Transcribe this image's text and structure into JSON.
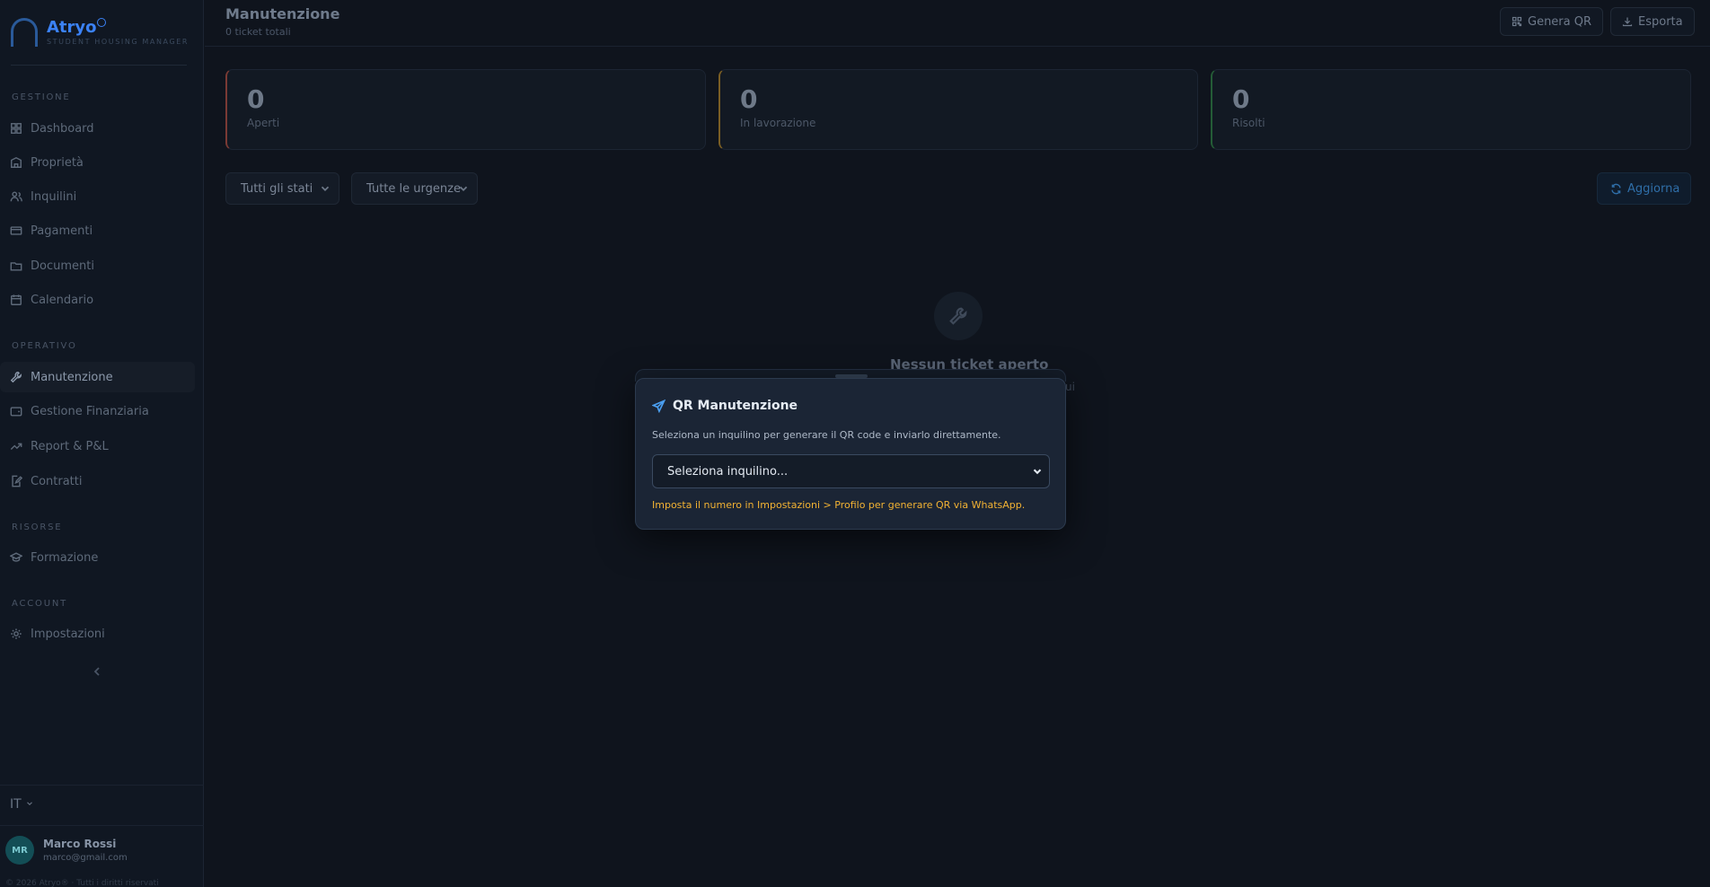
{
  "brand": {
    "name": "Atryo",
    "tagline": "STUDENT HOUSING MANAGER"
  },
  "sidebar": {
    "sections": [
      {
        "label": "GESTIONE",
        "items": [
          "Dashboard",
          "Proprietà",
          "Inquilini",
          "Pagamenti",
          "Documenti",
          "Calendario"
        ]
      },
      {
        "label": "OPERATIVO",
        "items": [
          "Manutenzione",
          "Gestione Finanziaria",
          "Report & P&L",
          "Contratti"
        ]
      },
      {
        "label": "RISORSE",
        "items": [
          "Formazione"
        ]
      },
      {
        "label": "ACCOUNT",
        "items": [
          "Impostazioni"
        ]
      }
    ],
    "active_item": "Manutenzione",
    "language": "IT",
    "user": {
      "initials": "MR",
      "name": "Marco Rossi",
      "email": "marco@gmail.com"
    },
    "copyright": "© 2026 Atryo® · Tutti i diritti riservati"
  },
  "header": {
    "title": "Manutenzione",
    "subtitle": "0 ticket totali",
    "genera_qr_label": "Genera QR",
    "esporta_label": "Esporta"
  },
  "stats": [
    {
      "value": "0",
      "label": "Aperti",
      "accent": "#b5453a"
    },
    {
      "value": "0",
      "label": "In lavorazione",
      "accent": "#b58a2a"
    },
    {
      "value": "0",
      "label": "Risolti",
      "accent": "#2f8a4a"
    }
  ],
  "filters": {
    "status_value": "Tutti gli stati",
    "urgency_value": "Tutte le urgenze",
    "refresh_label": "Aggiorna"
  },
  "empty_state": {
    "title": "Nessun ticket aperto",
    "trailing_text": "ui"
  },
  "modal": {
    "title": "QR Manutenzione",
    "description": "Seleziona un inquilino per generare il QR code e inviarlo direttamente.",
    "select_value": "Seleziona inquilino...",
    "warning": "Imposta il numero in Impostazioni > Profilo per generare QR via WhatsApp."
  },
  "colors": {
    "accent": "#3b82f6",
    "warning": "#f2b233",
    "background": "#0f141d"
  }
}
